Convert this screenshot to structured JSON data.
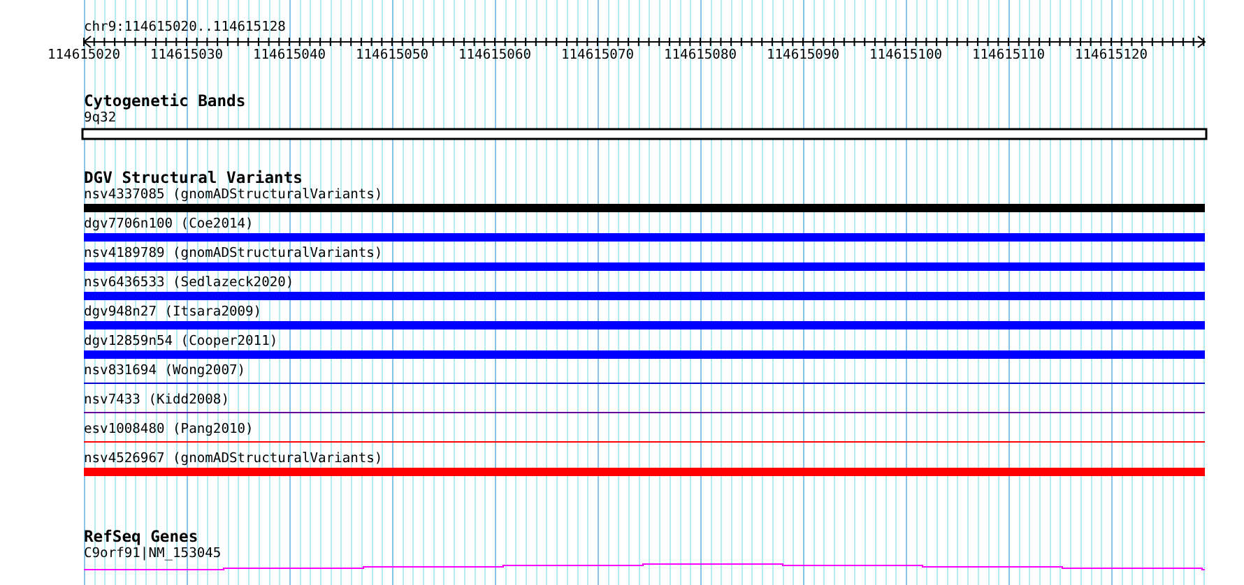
{
  "location": "chr9:114615020..114615128",
  "ruler": {
    "ticks": [
      "114615020",
      "114615030",
      "114615040",
      "114615050",
      "114615060",
      "114615070",
      "114615080",
      "114615090",
      "114615100",
      "114615110",
      "114615120"
    ]
  },
  "tracks": [
    {
      "kind": "cytoband",
      "title": "Cytogenetic Bands",
      "features": [
        {
          "label": "9q32"
        }
      ]
    },
    {
      "kind": "variants",
      "title": "DGV Structural Variants",
      "features": [
        {
          "label": "nsv4337085 (gnomADStructuralVariants)",
          "color": "#000000",
          "kind": "thick"
        },
        {
          "label": "dgv7706n100 (Coe2014)",
          "color": "#0000ff",
          "kind": "thick"
        },
        {
          "label": "nsv4189789 (gnomADStructuralVariants)",
          "color": "#0000ff",
          "kind": "thick"
        },
        {
          "label": "nsv6436533 (Sedlazeck2020)",
          "color": "#0000ff",
          "kind": "thick"
        },
        {
          "label": "dgv948n27 (Itsara2009)",
          "color": "#0000ff",
          "kind": "thick"
        },
        {
          "label": "dgv12859n54 (Cooper2011)",
          "color": "#0000ff",
          "kind": "thick"
        },
        {
          "label": "nsv831694 (Wong2007)",
          "color": "#0000cc",
          "kind": "thin"
        },
        {
          "label": "nsv7433 (Kidd2008)",
          "color": "#660099",
          "kind": "thin"
        },
        {
          "label": "esv1008480 (Pang2010)",
          "color": "#ff0000",
          "kind": "thin"
        },
        {
          "label": "nsv4526967 (gnomADStructuralVariants)",
          "color": "#ff0000",
          "kind": "thick"
        }
      ]
    },
    {
      "kind": "gene",
      "title": "RefSeq Genes",
      "features": [
        {
          "label": "C9orf91|NM_153045"
        }
      ]
    }
  ]
}
